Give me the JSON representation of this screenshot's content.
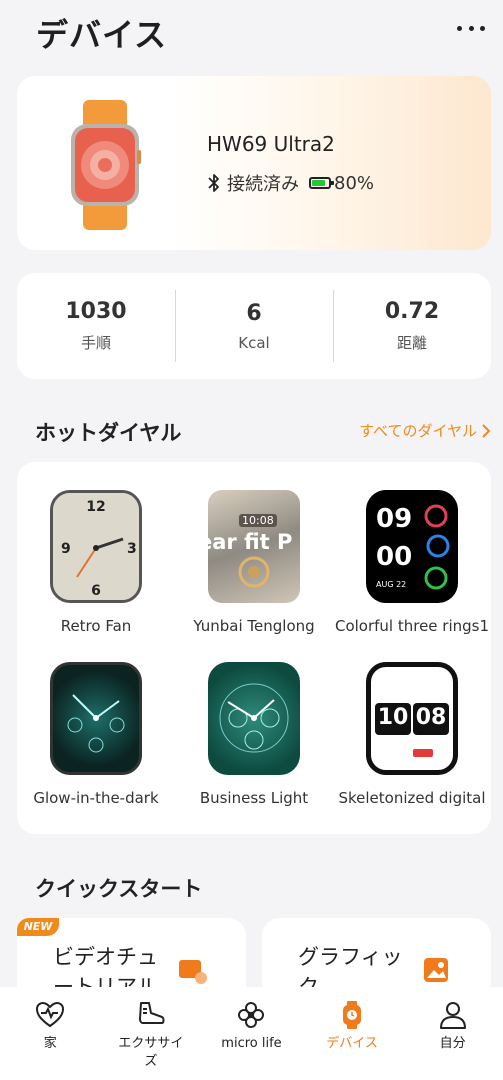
{
  "header": {
    "title": "デバイス",
    "more_icon": "more-dots-icon"
  },
  "device": {
    "name": "HW69 Ultra2",
    "status": "接続済み",
    "battery_percent": "80%",
    "battery_level": 0.8,
    "battery_color": "#22c83a"
  },
  "stats": [
    {
      "value": "1030",
      "label": "手順"
    },
    {
      "value": "6",
      "label": "Kcal"
    },
    {
      "value": "0.72",
      "label": "距離"
    }
  ],
  "hot_dials": {
    "title": "ホットダイヤル",
    "all_link": "すべてのダイヤル",
    "items": [
      {
        "name": "Retro Fan"
      },
      {
        "name": "Yunbai Tenglong",
        "overlay": "ear fit P",
        "time": "10:08"
      },
      {
        "name": "Colorful three rings1",
        "hours": "09",
        "minutes": "00",
        "date": "AUG 22"
      },
      {
        "name": "Glow-in-the-dark"
      },
      {
        "name": "Business Light"
      },
      {
        "name": "Skeletonized digital",
        "hours": "10",
        "minutes": "08"
      }
    ]
  },
  "quick_start": {
    "title": "クイックスタート",
    "badge": "NEW",
    "cards": [
      {
        "label": "ビデオチュートリアル"
      },
      {
        "label": "グラフィック"
      }
    ]
  },
  "tabbar": [
    {
      "label": "家",
      "icon": "heart-pulse-icon"
    },
    {
      "label": "エクササイズ",
      "icon": "shoe-icon"
    },
    {
      "label": "micro life",
      "icon": "flower-icon"
    },
    {
      "label": "デバイス",
      "icon": "watch-icon"
    },
    {
      "label": "自分",
      "icon": "person-icon"
    }
  ],
  "colors": {
    "accent": "#f08a1c",
    "active_tab": "#f07b1c"
  }
}
